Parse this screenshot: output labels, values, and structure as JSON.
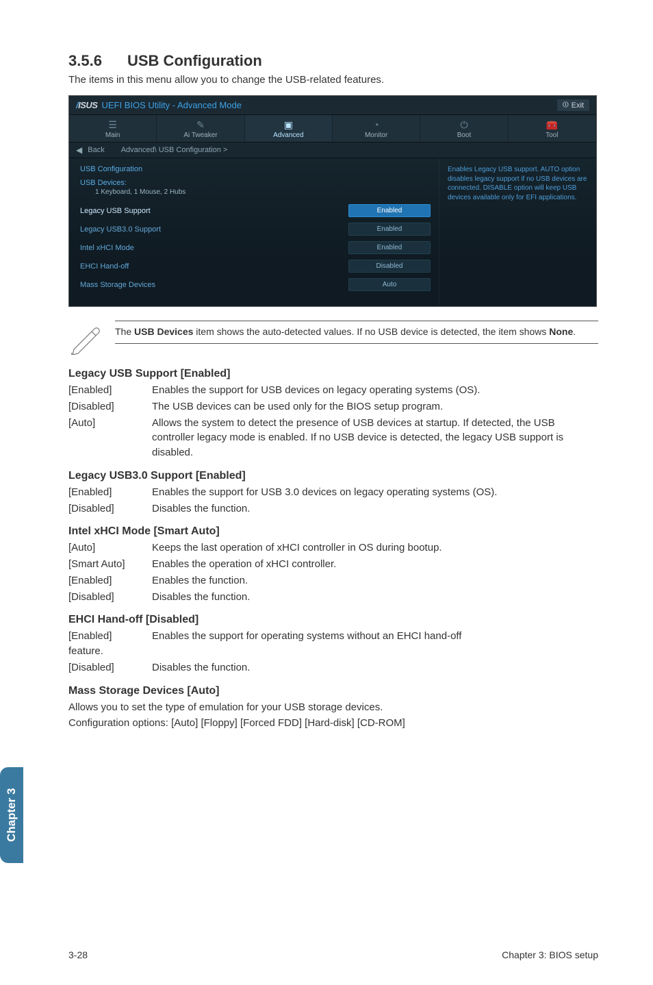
{
  "section": {
    "number": "3.5.6",
    "title": "USB Configuration",
    "intro": "The items in this menu allow you to change the USB-related features."
  },
  "bios": {
    "title_prefix_logo": "/SUS",
    "title_text": "UEFI BIOS Utility - Advanced Mode",
    "exit_label": "Exit",
    "tabs": {
      "main": "Main",
      "ai_tweaker": "Ai Tweaker",
      "advanced": "Advanced",
      "monitor": "Monitor",
      "boot": "Boot",
      "tool": "Tool"
    },
    "breadcrumb": {
      "back": "Back",
      "path": "Advanced\\ USB Configuration  >"
    },
    "left": {
      "header": "USB Configuration",
      "devices_label": "USB Devices:",
      "devices_value": "1 Keyboard, 1 Mouse, 2 Hubs",
      "rows": [
        {
          "label": "Legacy USB Support",
          "value": "Enabled",
          "selected": true
        },
        {
          "label": "Legacy USB3.0 Support",
          "value": "Enabled",
          "selected": false
        },
        {
          "label": "Intel xHCI Mode",
          "value": "Enabled",
          "selected": false
        },
        {
          "label": "EHCI Hand-off",
          "value": "Disabled",
          "selected": false
        },
        {
          "label": "Mass Storage Devices",
          "value": "Auto",
          "selected": false
        }
      ]
    },
    "help_text": "Enables Legacy USB support. AUTO option disables legacy support if no USB devices are connected. DISABLE option will keep USB devices available only for EFI applications."
  },
  "note": {
    "text_parts": {
      "pre": "The ",
      "bold1": "USB Devices",
      "mid": " item shows the auto-detected values. If no USB device is detected, the item shows ",
      "bold2": "None",
      "post": "."
    }
  },
  "subsections": [
    {
      "heading": "Legacy USB Support [Enabled]",
      "defs": [
        {
          "term": "[Enabled]",
          "desc": "Enables the support for USB devices on legacy operating systems (OS)."
        },
        {
          "term": "[Disabled]",
          "desc": "The USB devices can be used only for the BIOS setup program."
        },
        {
          "term": "[Auto]",
          "desc": "Allows the system to detect the presence of USB devices at startup. If detected, the USB controller legacy mode is enabled. If no USB device is detected, the legacy USB support is disabled."
        }
      ]
    },
    {
      "heading": "Legacy USB3.0 Support [Enabled]",
      "defs": [
        {
          "term": "[Enabled]",
          "desc": "Enables the support for USB 3.0 devices on legacy operating systems (OS)."
        },
        {
          "term": "[Disabled]",
          "desc": "Disables the function."
        }
      ]
    },
    {
      "heading": "Intel xHCI Mode [Smart Auto]",
      "defs": [
        {
          "term": "[Auto]",
          "desc": "Keeps the last operation of xHCI controller in OS during bootup."
        },
        {
          "term": "[Smart Auto]",
          "desc": "Enables the operation of xHCI controller."
        },
        {
          "term": "[Enabled]",
          "desc": "Enables the function."
        },
        {
          "term": "[Disabled]",
          "desc": "Disables the function."
        }
      ]
    },
    {
      "heading": "EHCI Hand-off [Disabled]",
      "defs": [
        {
          "term": "[Enabled] feature.",
          "desc": "Enables the support for operating systems without an EHCI hand-off"
        },
        {
          "term": "[Disabled]",
          "desc": "Disables the function."
        }
      ],
      "special_first_row": true
    },
    {
      "heading": "Mass Storage Devices [Auto]",
      "body": [
        "Allows you to set the type of emulation for your USB storage devices.",
        "Configuration options: [Auto] [Floppy] [Forced FDD] [Hard-disk] [CD-ROM]"
      ]
    }
  ],
  "side_tab": "Chapter 3",
  "footer": {
    "left": "3-28",
    "right": "Chapter 3: BIOS setup"
  }
}
